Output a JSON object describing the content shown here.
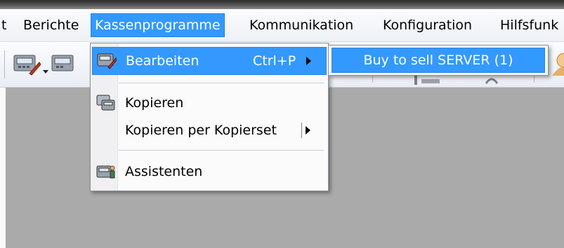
{
  "menubar": {
    "items": [
      {
        "label": "t"
      },
      {
        "label": "Berichte"
      },
      {
        "label": "Kassenprogramme"
      },
      {
        "label": "Kommunikation"
      },
      {
        "label": "Konfiguration"
      },
      {
        "label": "Hilfsfunk"
      }
    ]
  },
  "dropdown": {
    "items": [
      {
        "label": "Bearbeiten",
        "shortcut": "Ctrl+P",
        "icon": "register-edit-icon"
      },
      {
        "label": "Kopieren",
        "icon": "copy-register-icon"
      },
      {
        "label": "Kopieren per Kopierset"
      },
      {
        "label": "Assistenten",
        "icon": "wizard-icon"
      }
    ]
  },
  "submenu": {
    "items": [
      {
        "label": "Buy to sell SERVER (1)"
      }
    ]
  },
  "colors": {
    "highlight": "#3399ff",
    "workspace": "#aaaaaa"
  }
}
